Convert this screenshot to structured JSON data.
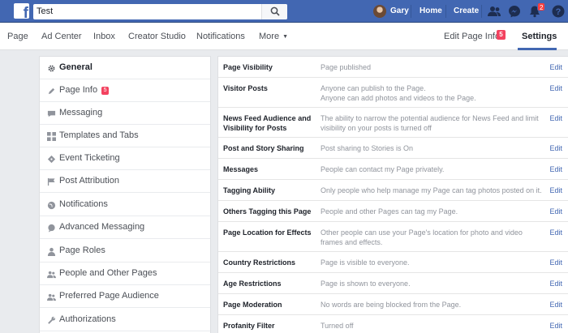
{
  "topbar": {
    "logo": "f",
    "search_value": "Test",
    "user_name": "Gary",
    "home": "Home",
    "create": "Create",
    "notifications_count": "2",
    "icons": [
      "search-icon",
      "friends-icon",
      "messenger-icon",
      "bell-icon",
      "help-icon"
    ],
    "color": "#4267b2"
  },
  "pagenav": {
    "items": [
      "Page",
      "Ad Center",
      "Inbox",
      "Creator Studio",
      "Notifications",
      "More"
    ],
    "edit_page_info": "Edit Page Info",
    "edit_badge": "5",
    "settings": "Settings"
  },
  "sidebar": {
    "items": [
      {
        "label": "General",
        "icon": "gear-icon",
        "active": true
      },
      {
        "label": "Page Info",
        "icon": "pencil-icon",
        "badge": "5"
      },
      {
        "label": "Messaging",
        "icon": "chat-bubble-icon"
      },
      {
        "label": "Templates and Tabs",
        "icon": "grid-icon"
      },
      {
        "label": "Event Ticketing",
        "icon": "ticket-icon"
      },
      {
        "label": "Post Attribution",
        "icon": "flag-icon"
      },
      {
        "label": "Notifications",
        "icon": "globe-icon"
      },
      {
        "label": "Advanced Messaging",
        "icon": "chat-bubble-icon"
      },
      {
        "label": "Page Roles",
        "icon": "person-icon"
      },
      {
        "label": "People and Other Pages",
        "icon": "people-icon"
      },
      {
        "label": "Preferred Page Audience",
        "icon": "people-icon"
      },
      {
        "label": "Authorizations",
        "icon": "wrench-icon"
      }
    ]
  },
  "settings": {
    "edit_label": "Edit",
    "rows": [
      {
        "label": "Page Visibility",
        "desc": "Page published"
      },
      {
        "label": "Visitor Posts",
        "desc": "Anyone can publish to the Page.\nAnyone can add photos and videos to the Page."
      },
      {
        "label": "News Feed Audience and Visibility for Posts",
        "desc": "The ability to narrow the potential audience for News Feed and limit visibility on your posts is turned off"
      },
      {
        "label": "Post and Story Sharing",
        "desc": "Post sharing to Stories is On"
      },
      {
        "label": "Messages",
        "desc": "People can contact my Page privately."
      },
      {
        "label": "Tagging Ability",
        "desc": "Only people who help manage my Page can tag photos posted on it."
      },
      {
        "label": "Others Tagging this Page",
        "desc": "People and other Pages can tag my Page."
      },
      {
        "label": "Page Location for Effects",
        "desc": "Other people can use your Page's location for photo and video frames and effects."
      },
      {
        "label": "Country Restrictions",
        "desc": "Page is visible to everyone."
      },
      {
        "label": "Age Restrictions",
        "desc": "Page is shown to everyone."
      },
      {
        "label": "Page Moderation",
        "desc": "No words are being blocked from the Page."
      },
      {
        "label": "Profanity Filter",
        "desc": "Turned off"
      }
    ]
  }
}
